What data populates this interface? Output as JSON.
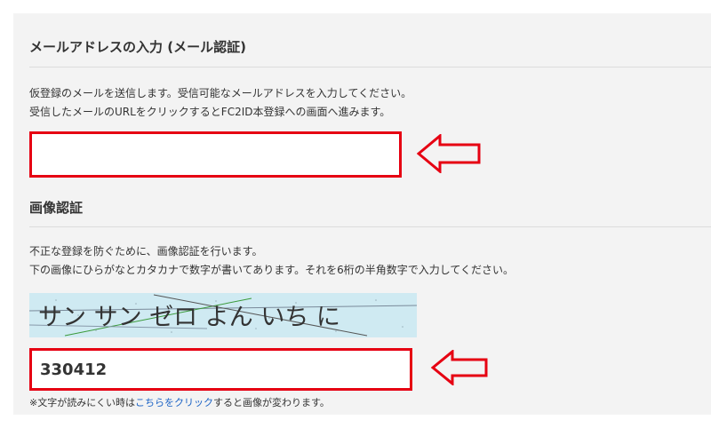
{
  "email_section": {
    "heading": "メールアドレスの入力 (メール認証)",
    "desc_line1": "仮登録のメールを送信します。受信可能なメールアドレスを入力してください。",
    "desc_line2": "受信したメールのURLをクリックするとFC2ID本登録への画面へ進みます。",
    "email_value": "",
    "arrow_icon": "left-arrow-icon"
  },
  "captcha_section": {
    "heading": "画像認証",
    "desc_line1": "不正な登録を防ぐために、画像認証を行います。",
    "desc_line2": "下の画像にひらがなとカタカナで数字が書いてあります。それを6桁の半角数字で入力してください。",
    "captcha_text": "サン サン ゼロ よん いち に",
    "code_value": "330412",
    "note_prefix": "※文字が読みにくい時は",
    "note_link": "こちらをクリック",
    "note_suffix": "すると画像が変わります。",
    "arrow_icon": "left-arrow-icon"
  },
  "colors": {
    "highlight": "#e60012",
    "link": "#1a62c5",
    "panel": "#f3f3f3",
    "captcha_bg": "#cfeaf2"
  }
}
